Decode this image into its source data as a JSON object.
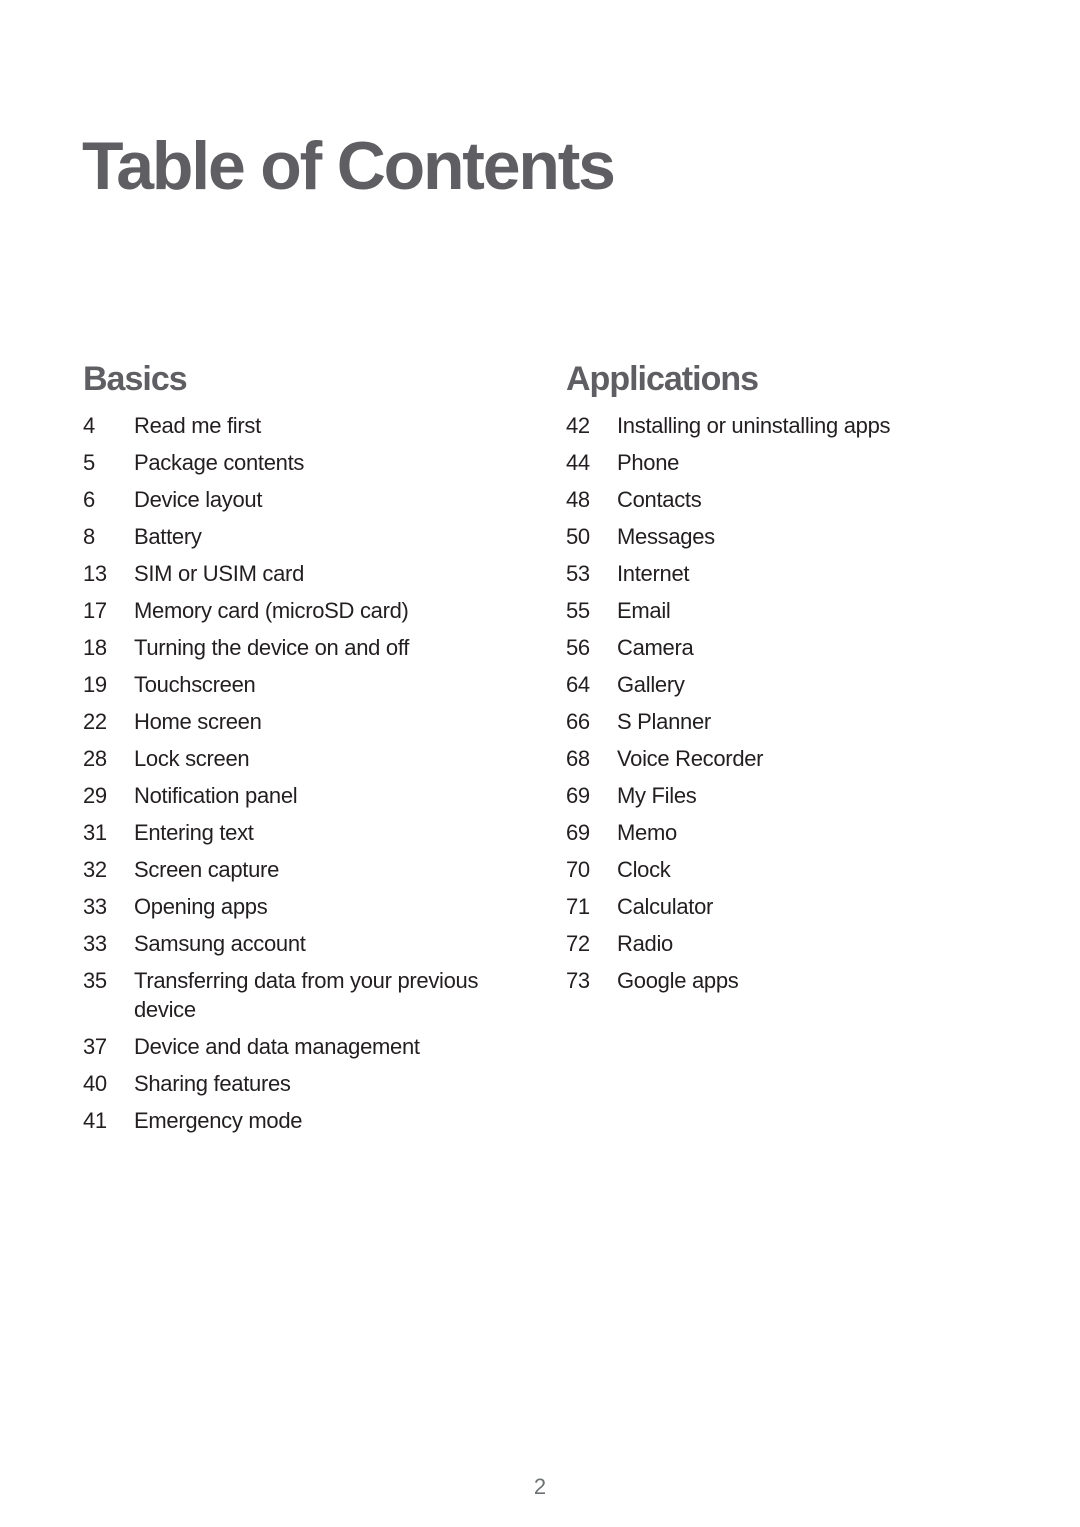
{
  "title": "Table of Contents",
  "sections": [
    {
      "heading": "Basics",
      "entries": [
        {
          "page": "4",
          "label": "Read me first"
        },
        {
          "page": "5",
          "label": "Package contents"
        },
        {
          "page": "6",
          "label": "Device layout"
        },
        {
          "page": "8",
          "label": "Battery"
        },
        {
          "page": "13",
          "label": "SIM or USIM card"
        },
        {
          "page": "17",
          "label": "Memory card (microSD card)"
        },
        {
          "page": "18",
          "label": "Turning the device on and off"
        },
        {
          "page": "19",
          "label": "Touchscreen"
        },
        {
          "page": "22",
          "label": "Home screen"
        },
        {
          "page": "28",
          "label": "Lock screen"
        },
        {
          "page": "29",
          "label": "Notification panel"
        },
        {
          "page": "31",
          "label": "Entering text"
        },
        {
          "page": "32",
          "label": "Screen capture"
        },
        {
          "page": "33",
          "label": "Opening apps"
        },
        {
          "page": "33",
          "label": "Samsung account"
        },
        {
          "page": "35",
          "label": "Transferring data from your previous device"
        },
        {
          "page": "37",
          "label": "Device and data management"
        },
        {
          "page": "40",
          "label": "Sharing features"
        },
        {
          "page": "41",
          "label": "Emergency mode"
        }
      ]
    },
    {
      "heading": "Applications",
      "entries": [
        {
          "page": "42",
          "label": "Installing or uninstalling apps"
        },
        {
          "page": "44",
          "label": "Phone"
        },
        {
          "page": "48",
          "label": "Contacts"
        },
        {
          "page": "50",
          "label": "Messages"
        },
        {
          "page": "53",
          "label": "Internet"
        },
        {
          "page": "55",
          "label": "Email"
        },
        {
          "page": "56",
          "label": "Camera"
        },
        {
          "page": "64",
          "label": "Gallery"
        },
        {
          "page": "66",
          "label": "S Planner"
        },
        {
          "page": "68",
          "label": "Voice Recorder"
        },
        {
          "page": "69",
          "label": "My Files"
        },
        {
          "page": "69",
          "label": "Memo"
        },
        {
          "page": "70",
          "label": "Clock"
        },
        {
          "page": "71",
          "label": "Calculator"
        },
        {
          "page": "72",
          "label": "Radio"
        },
        {
          "page": "73",
          "label": "Google apps"
        }
      ]
    }
  ],
  "page_number": "2"
}
